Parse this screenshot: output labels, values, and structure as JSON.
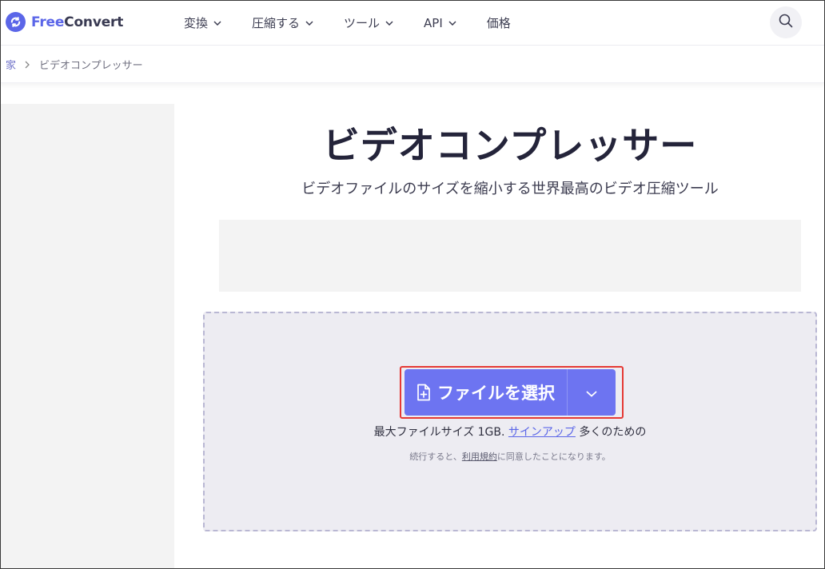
{
  "header": {
    "logo_free": "Free",
    "logo_convert": "Convert",
    "nav": [
      {
        "label": "変換"
      },
      {
        "label": "圧縮する"
      },
      {
        "label": "ツール"
      },
      {
        "label": "API"
      },
      {
        "label": "価格"
      }
    ]
  },
  "breadcrumb": {
    "home": "家",
    "current": "ビデオコンプレッサー"
  },
  "main": {
    "title": "ビデオコンプレッサー",
    "subtitle": "ビデオファイルのサイズを縮小する世界最高のビデオ圧縮ツール",
    "upload": {
      "button_label": "ファイルを選択",
      "max_size_prefix": "最大ファイルサイズ 1GB.",
      "signup_link": "サインアップ",
      "max_size_suffix": "多くのための",
      "terms_prefix": "続行すると、",
      "terms_link": "利用規約",
      "terms_suffix": "に同意したことになります。"
    }
  },
  "colors": {
    "accent": "#6d74f1",
    "brand": "#5b66e8",
    "highlight": "#e53935"
  }
}
